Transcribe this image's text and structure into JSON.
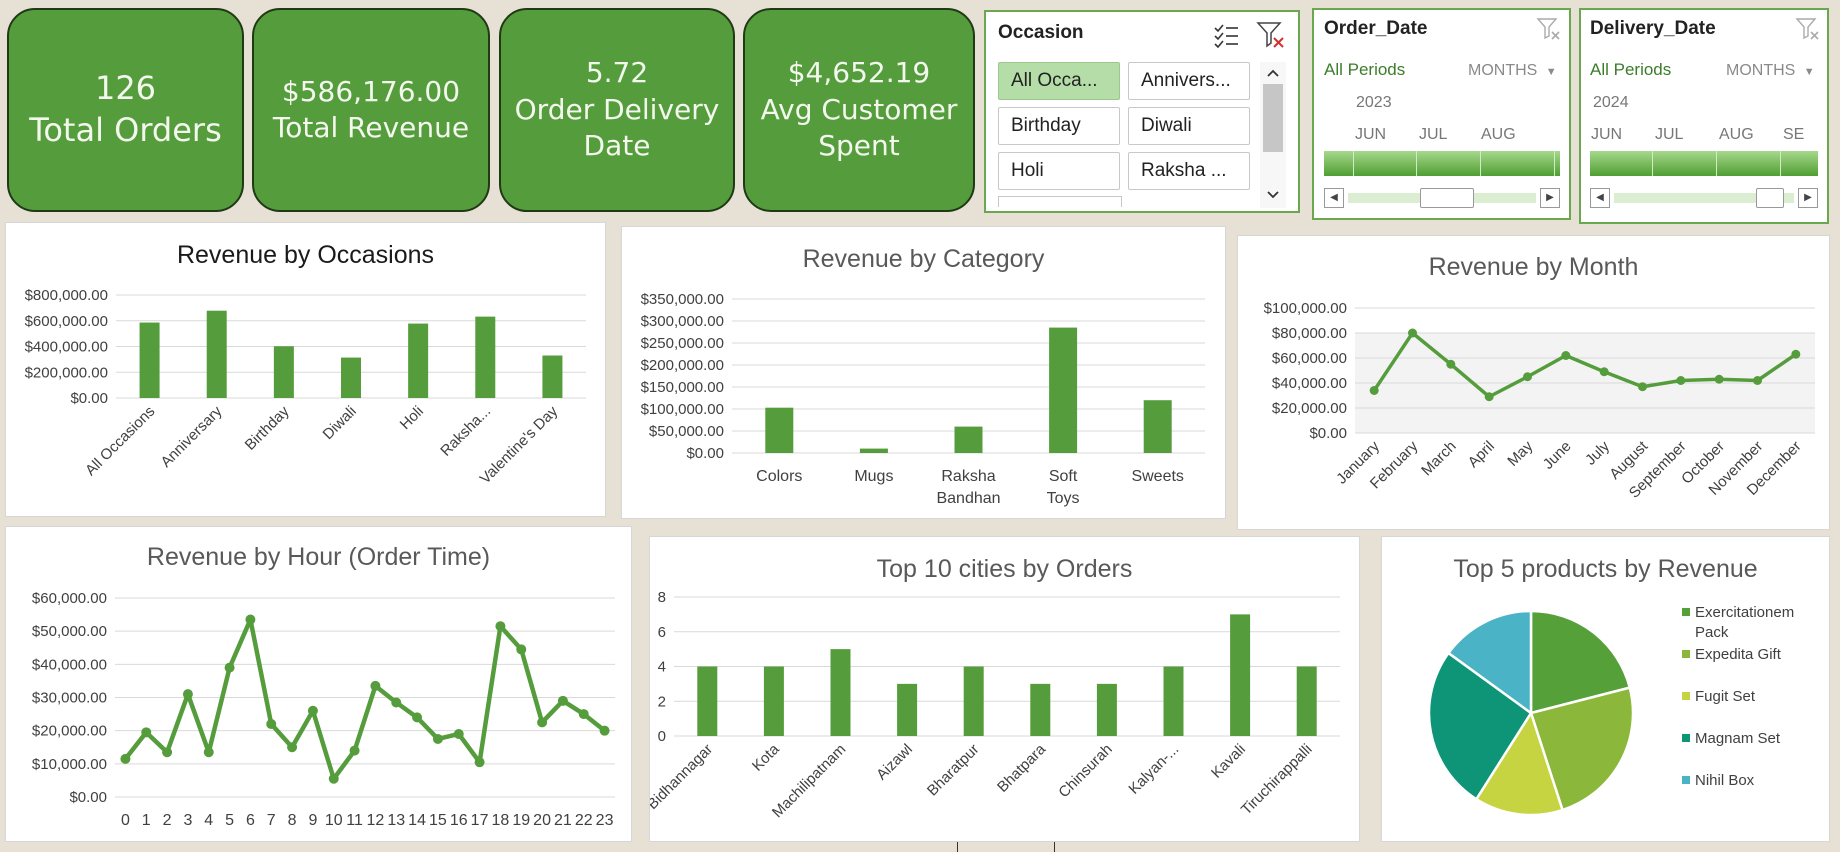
{
  "kpis": [
    {
      "lines": [
        "126",
        "Total Orders"
      ]
    },
    {
      "lines": [
        "$586,176.00",
        "Total Revenue"
      ]
    },
    {
      "lines": [
        "5.72",
        "Order Delivery",
        "Date"
      ]
    },
    {
      "lines": [
        "$4,652.19",
        "Avg Customer",
        "Spent"
      ]
    }
  ],
  "occasion_slicer": {
    "title": "Occasion",
    "items": [
      "All Occa...",
      "Annivers...",
      "Birthday",
      "Diwali",
      "Holi",
      "Raksha ..."
    ],
    "selected": "All Occa..."
  },
  "order_date_timeline": {
    "title": "Order_Date",
    "periods_label": "All Periods",
    "level": "MONTHS",
    "year": "2023",
    "months": [
      "JUN",
      "JUL",
      "AUG"
    ]
  },
  "delivery_date_timeline": {
    "title": "Delivery_Date",
    "periods_label": "All Periods",
    "level": "MONTHS",
    "year": "2024",
    "months": [
      "JUN",
      "JUL",
      "AUG",
      "SE"
    ]
  },
  "colors": {
    "kpi_fill": "#559d3c",
    "bar": "#559d3c",
    "line": "#559d3c",
    "slicer_border": "#6aa84f",
    "slicer_selected": "#b4dda8",
    "pie": [
      "#56a03a",
      "#8bb83a",
      "#c5d440",
      "#0e9577",
      "#4ab4c6"
    ]
  },
  "chart_data": [
    {
      "id": "occasions",
      "type": "bar",
      "title": "Revenue by Occasions",
      "categories": [
        "All Occasions",
        "Anniversary",
        "Birthday",
        "Diwali",
        "Holi",
        "Raksha...",
        "Valentine's Day"
      ],
      "values": [
        586000,
        678000,
        402000,
        314000,
        578000,
        632000,
        330000
      ],
      "yticks": [
        "$0.00",
        "$200,000.00",
        "$400,000.00",
        "$600,000.00",
        "$800,000.00"
      ],
      "ylim": [
        0,
        800000
      ]
    },
    {
      "id": "category",
      "type": "bar",
      "title": "Revenue by Category",
      "categories": [
        "Colors",
        "Mugs",
        "Raksha Bandhan",
        "Soft Toys",
        "Sweets"
      ],
      "values": [
        103000,
        10000,
        60000,
        285000,
        120000
      ],
      "yticks": [
        "$0.00",
        "$50,000.00",
        "$100,000.00",
        "$150,000.00",
        "$200,000.00",
        "$250,000.00",
        "$300,000.00",
        "$350,000.00"
      ],
      "ylim": [
        0,
        350000
      ]
    },
    {
      "id": "month",
      "type": "line",
      "title": "Revenue by Month",
      "categories": [
        "January",
        "February",
        "March",
        "April",
        "May",
        "June",
        "July",
        "August",
        "September",
        "October",
        "November",
        "December"
      ],
      "values": [
        34000,
        80000,
        55000,
        29000,
        45000,
        62000,
        49000,
        37000,
        42000,
        43000,
        42000,
        63000
      ],
      "yticks": [
        "$0.00",
        "$20,000.00",
        "$40,000.00",
        "$60,000.00",
        "$80,000.00",
        "$100,000.00"
      ],
      "ylim": [
        0,
        100000
      ]
    },
    {
      "id": "hour",
      "type": "line",
      "title": "Revenue by Hour (Order Time)",
      "categories": [
        "0",
        "1",
        "2",
        "3",
        "4",
        "5",
        "6",
        "7",
        "8",
        "9",
        "10",
        "11",
        "12",
        "13",
        "14",
        "15",
        "16",
        "17",
        "18",
        "19",
        "20",
        "21",
        "22",
        "23"
      ],
      "values": [
        11500,
        19500,
        13500,
        31000,
        13500,
        39000,
        53500,
        22000,
        15000,
        26000,
        5500,
        14000,
        33500,
        28500,
        24000,
        17500,
        19000,
        10500,
        51500,
        44500,
        22500,
        29000,
        25000,
        20000
      ],
      "yticks": [
        "$0.00",
        "$10,000.00",
        "$20,000.00",
        "$30,000.00",
        "$40,000.00",
        "$50,000.00",
        "$60,000.00"
      ],
      "ylim": [
        0,
        60000
      ]
    },
    {
      "id": "cities",
      "type": "bar",
      "title": "Top 10 cities by Orders",
      "categories": [
        "Bidhannagar",
        "Kota",
        "Machilipatnam",
        "Aizawl",
        "Bharatpur",
        "Bhatpara",
        "Chinsurah",
        "Kalyan-...",
        "Kavali",
        "Tiruchirappalli"
      ],
      "values": [
        4,
        4,
        5,
        3,
        4,
        3,
        3,
        4,
        7,
        4
      ],
      "yticks": [
        "0",
        "2",
        "4",
        "6",
        "8"
      ],
      "ylim": [
        0,
        8
      ]
    },
    {
      "id": "products",
      "type": "pie",
      "title": "Top 5 products by Revenue",
      "categories": [
        "Exercitationem Pack",
        "Expedita Gift",
        "Fugit Set",
        "Magnam Set",
        "Nihil Box"
      ],
      "values": [
        21,
        24,
        14,
        26,
        15
      ]
    }
  ]
}
